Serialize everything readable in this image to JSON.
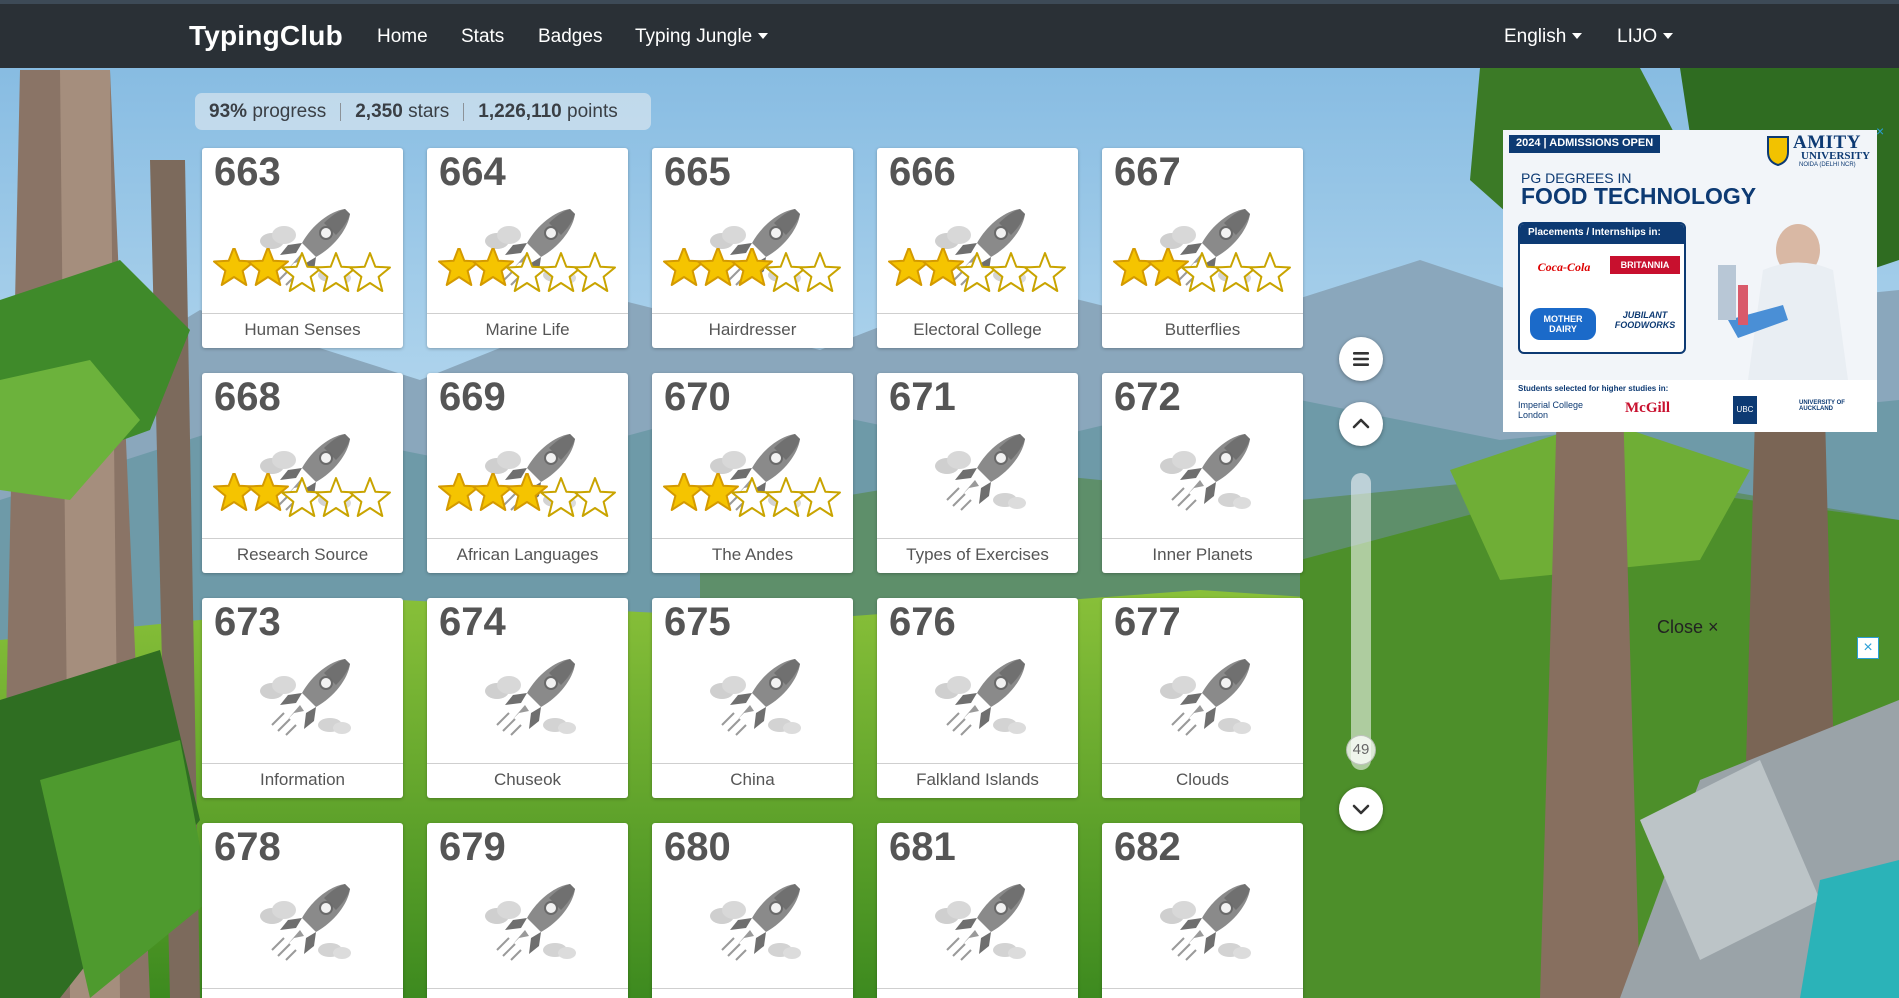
{
  "navbar": {
    "brand": "TypingClub",
    "links": [
      "Home",
      "Stats",
      "Badges"
    ],
    "jungle_label": "Typing Jungle",
    "language_label": "English",
    "user_label": "LIJO"
  },
  "stats": {
    "progress_value": "93%",
    "progress_unit": "progress",
    "stars_value": "2,350",
    "stars_unit": "stars",
    "points_value": "1,226,110",
    "points_unit": "points"
  },
  "lessons": [
    {
      "number": "663",
      "title": "Human Senses",
      "stars": 2
    },
    {
      "number": "664",
      "title": "Marine Life",
      "stars": 2
    },
    {
      "number": "665",
      "title": "Hairdresser",
      "stars": 3
    },
    {
      "number": "666",
      "title": "Electoral College",
      "stars": 2
    },
    {
      "number": "667",
      "title": "Butterflies",
      "stars": 2
    },
    {
      "number": "668",
      "title": "Research Source",
      "stars": 2
    },
    {
      "number": "669",
      "title": "African Languages",
      "stars": 3
    },
    {
      "number": "670",
      "title": "The Andes",
      "stars": 2
    },
    {
      "number": "671",
      "title": "Types of Exercises",
      "stars": 0
    },
    {
      "number": "672",
      "title": "Inner Planets",
      "stars": 0
    },
    {
      "number": "673",
      "title": "Information",
      "stars": 0
    },
    {
      "number": "674",
      "title": "Chuseok",
      "stars": 0
    },
    {
      "number": "675",
      "title": "China",
      "stars": 0
    },
    {
      "number": "676",
      "title": "Falkland Islands",
      "stars": 0
    },
    {
      "number": "677",
      "title": "Clouds",
      "stars": 0
    },
    {
      "number": "678",
      "title": "",
      "stars": 0
    },
    {
      "number": "679",
      "title": "",
      "stars": 0
    },
    {
      "number": "680",
      "title": "",
      "stars": 0
    },
    {
      "number": "681",
      "title": "",
      "stars": 0
    },
    {
      "number": "682",
      "title": "",
      "stars": 0
    }
  ],
  "scroll": {
    "position_label": "49"
  },
  "ad": {
    "badge": "2024 | ADMISSIONS OPEN",
    "university": "AMITY",
    "university_sub": "UNIVERSITY",
    "university_loc": "NOIDA (DELHI NCR)",
    "line1": "PG DEGREES IN",
    "line2": "FOOD TECHNOLOGY",
    "placements_head": "Placements / Internships in:",
    "companies": [
      "Coca-Cola",
      "BRITANNIA",
      "MOTHER DAIRY",
      "JUBILANT FOODWORKS"
    ],
    "students_head": "Students selected for higher studies in:",
    "schools": [
      "Imperial College London",
      "McGill",
      "UBC",
      "UNIVERSITY OF AUCKLAND"
    ],
    "x_icon": "×"
  },
  "close": {
    "label": "Close",
    "x_icon": "×"
  },
  "ad_close_icon": "×",
  "colors": {
    "navbar": "#2a3036",
    "star_gold": "#f5c400",
    "rocket_gray": "#8a8a8a",
    "ad_blue": "#0d3a73"
  }
}
